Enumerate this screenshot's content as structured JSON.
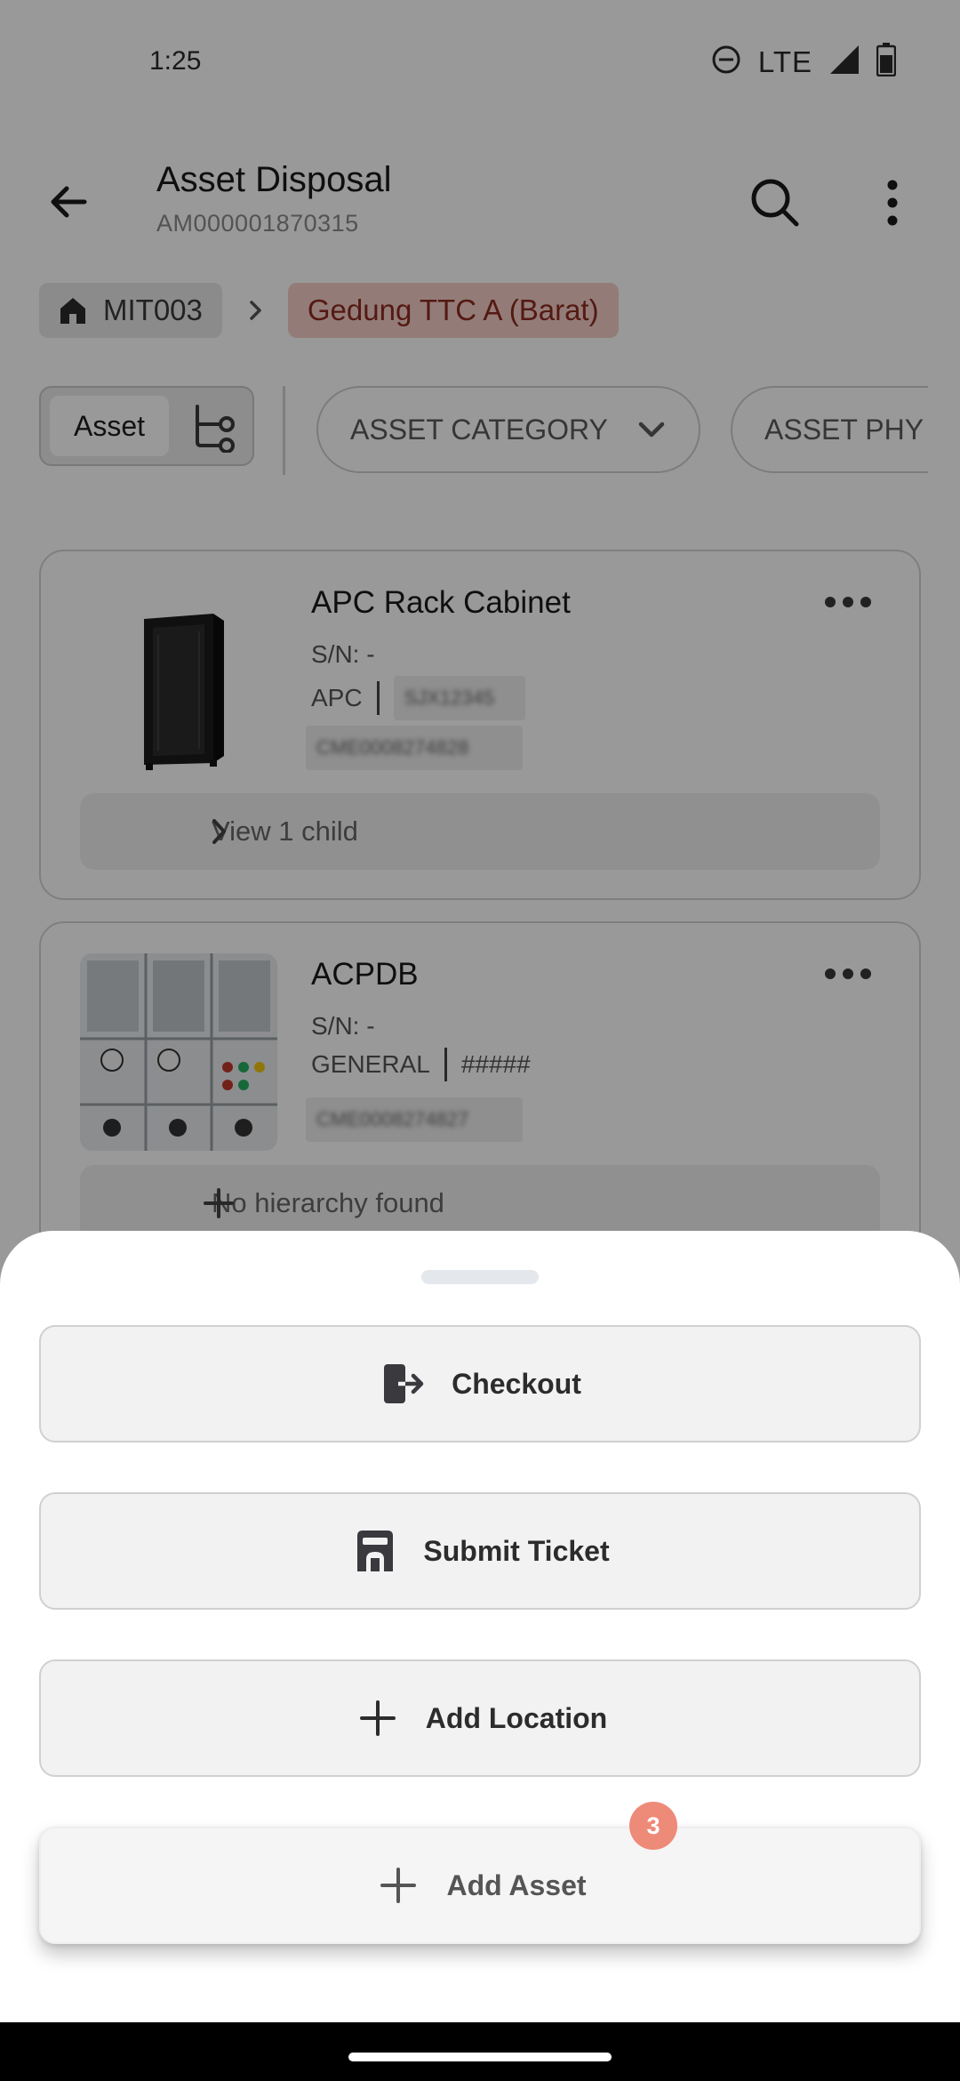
{
  "status_bar": {
    "time": "1:25",
    "network": "LTE"
  },
  "header": {
    "title": "Asset Disposal",
    "subtitle": "AM000001870315"
  },
  "breadcrumb": {
    "home": "MIT003",
    "current": "Gedung TTC A (Barat)"
  },
  "view_toggle": {
    "asset_label": "Asset"
  },
  "filters": [
    "ASSET CATEGORY",
    "ASSET PHY"
  ],
  "assets": [
    {
      "name": "APC Rack Cabinet",
      "serial": "S/N: -",
      "brand": "APC",
      "model": "SJX12345",
      "code": "CME0008274828",
      "child": "View 1 child"
    },
    {
      "name": "ACPDB",
      "serial": "S/N: -",
      "brand": "GENERAL",
      "model": "#####",
      "code": "CME0008274827",
      "child": "No hierarchy found"
    }
  ],
  "sheet": {
    "checkout": "Checkout",
    "submit_ticket": "Submit Ticket",
    "add_location": "Add Location",
    "add_asset": "Add Asset",
    "step_badge": "3"
  },
  "colors": {
    "accent": "#ee8a78",
    "breadcrumb_bg": "#f5cfc9",
    "breadcrumb_text": "#8e2a20"
  }
}
